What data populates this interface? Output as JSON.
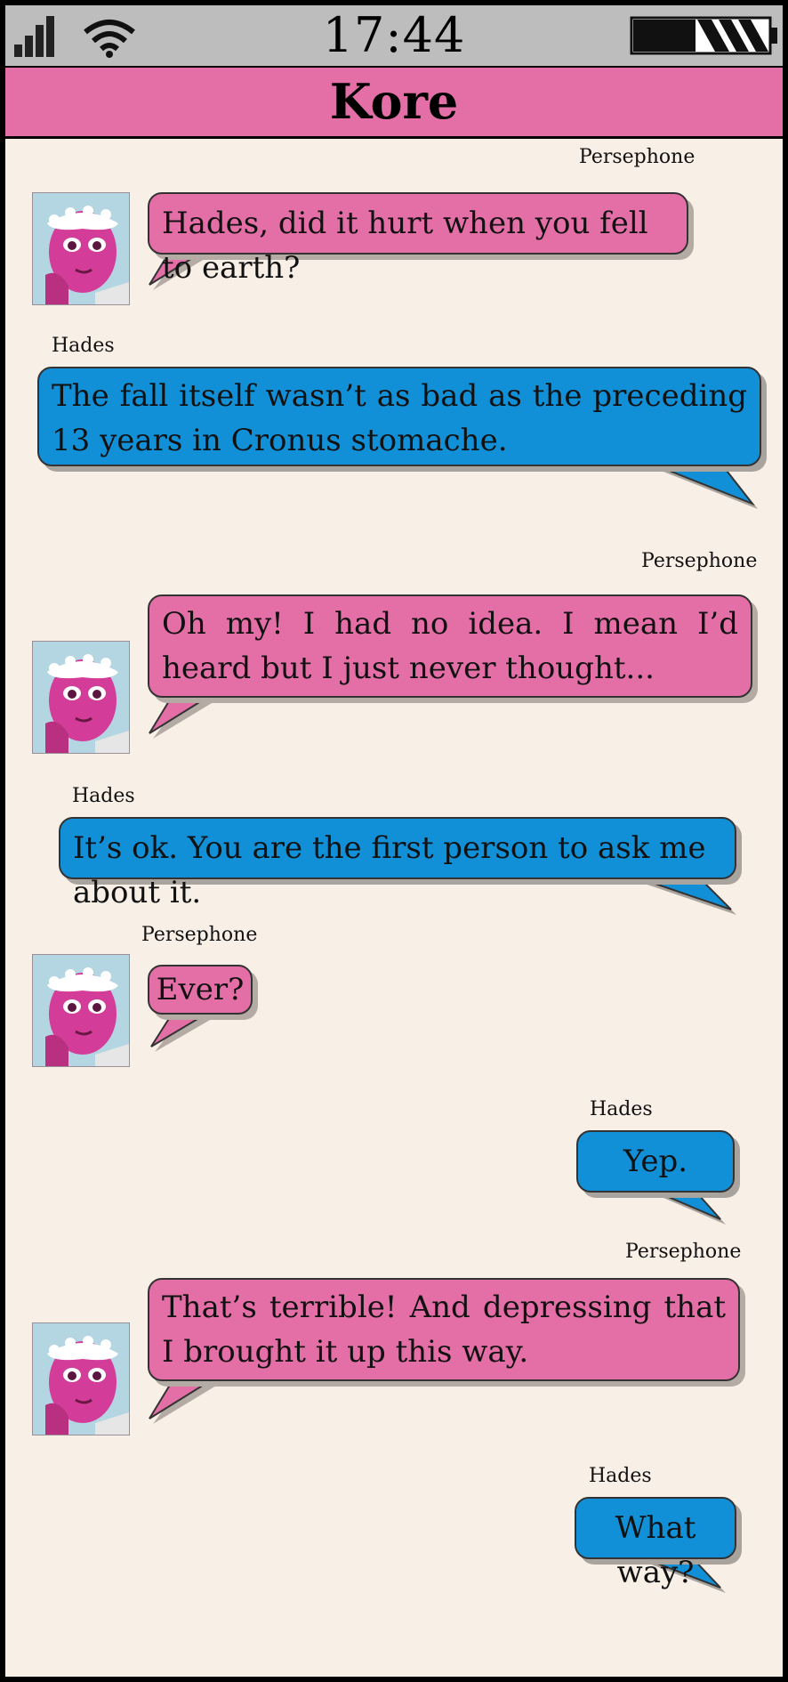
{
  "status_bar": {
    "time": "17:44",
    "icons": [
      "signal-icon",
      "wifi-icon",
      "battery-icon"
    ]
  },
  "header": {
    "contact_name": "Kore"
  },
  "colors": {
    "persephone_bubble": "#e46fa7",
    "hades_bubble": "#1190d8",
    "chat_background": "#f8efe6",
    "status_bar": "#bdbdbd"
  },
  "messages": [
    {
      "sender": "Persephone",
      "text": "Hades, did it hurt when you fell to earth?"
    },
    {
      "sender": "Hades",
      "text": "The fall itself wasn’t as bad as the preceding 13 years in Cronus stomache."
    },
    {
      "sender": "Persephone",
      "text": "Oh my! I had no idea. I mean I’d heard but I just never thought..."
    },
    {
      "sender": "Hades",
      "text": "It’s ok. You are the first person to ask me about it."
    },
    {
      "sender": "Persephone",
      "text": "Ever?"
    },
    {
      "sender": "Hades",
      "text": "Yep."
    },
    {
      "sender": "Persephone",
      "text": "That’s terrible! And depressing that I brought it up this way."
    },
    {
      "sender": "Hades",
      "text": "What way?"
    }
  ]
}
